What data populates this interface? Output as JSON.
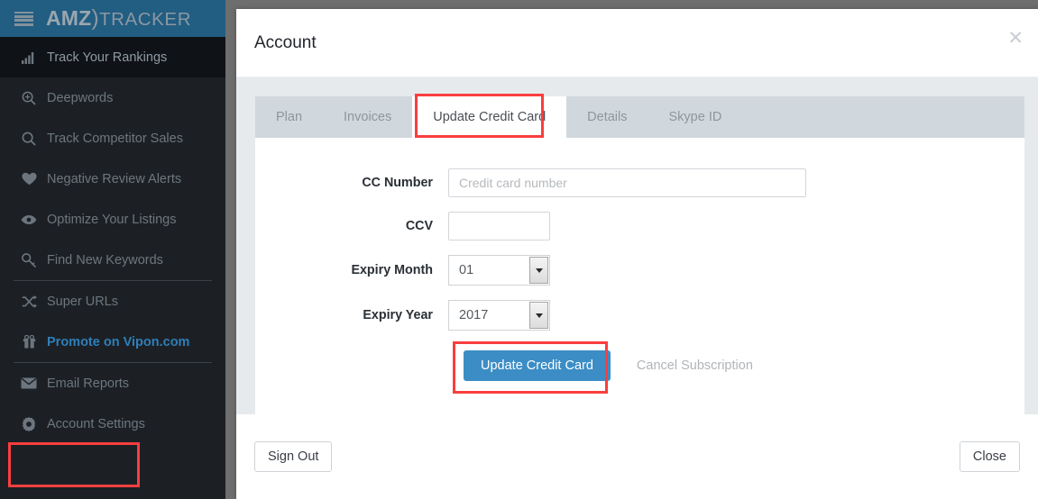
{
  "brand": {
    "name_bold": "AMZ",
    "paren": ")",
    "name_light": "TRACKER",
    "menu_icon": "hamburger-icon"
  },
  "sidebar": {
    "items": [
      {
        "label": "Track Your Rankings",
        "icon": "bar-chart-icon",
        "active": true
      },
      {
        "label": "Deepwords",
        "icon": "zoom-in-icon",
        "active": false
      },
      {
        "label": "Track Competitor Sales",
        "icon": "search-icon",
        "active": false
      },
      {
        "label": "Negative Review Alerts",
        "icon": "heart-icon",
        "active": false
      },
      {
        "label": "Optimize Your Listings",
        "icon": "eye-icon",
        "active": false
      },
      {
        "label": "Find New Keywords",
        "icon": "key-icon",
        "active": false
      },
      {
        "label": "Super URLs",
        "icon": "shuffle-icon",
        "active": false
      },
      {
        "label": "Promote on Vipon.com",
        "icon": "gift-icon",
        "active": false
      },
      {
        "label": "Email Reports",
        "icon": "envelope-icon",
        "active": false
      },
      {
        "label": "Account Settings",
        "icon": "gear-icon",
        "active": false
      }
    ]
  },
  "modal": {
    "title": "Account",
    "close_icon": "close-icon",
    "tabs": [
      {
        "label": "Plan",
        "active": false
      },
      {
        "label": "Invoices",
        "active": false
      },
      {
        "label": "Update Credit Card",
        "active": true
      },
      {
        "label": "Details",
        "active": false
      },
      {
        "label": "Skype ID",
        "active": false
      }
    ],
    "form": {
      "cc_number": {
        "label": "CC Number",
        "value": "",
        "placeholder": "Credit card number"
      },
      "ccv": {
        "label": "CCV",
        "value": "",
        "placeholder": ""
      },
      "expiry_month": {
        "label": "Expiry Month",
        "value": "01"
      },
      "expiry_year": {
        "label": "Expiry Year",
        "value": "2017"
      }
    },
    "actions": {
      "update_label": "Update Credit Card",
      "cancel_label": "Cancel Subscription"
    },
    "footer": {
      "sign_out_label": "Sign Out",
      "close_label": "Close"
    }
  },
  "highlights": {
    "accent_red": "#f93e3e",
    "primary_blue": "#3c8dc5",
    "brand_blue": "#225d82"
  }
}
